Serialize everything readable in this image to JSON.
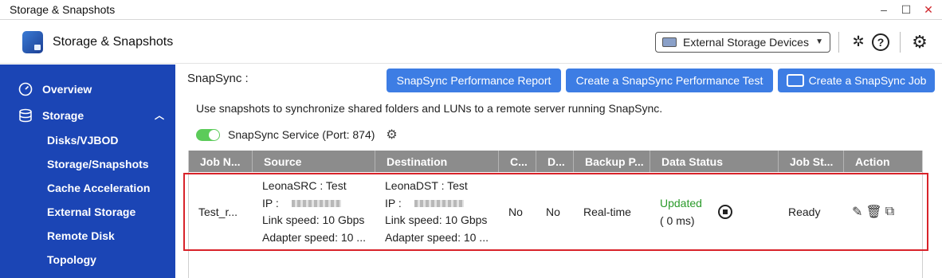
{
  "window": {
    "title": "Storage & Snapshots"
  },
  "app": {
    "title": "Storage & Snapshots",
    "external_select": "External Storage Devices"
  },
  "sidebar": {
    "items": [
      {
        "label": "Overview"
      },
      {
        "label": "Storage"
      }
    ],
    "subitems": [
      {
        "label": "Disks/VJBOD"
      },
      {
        "label": "Storage/Snapshots"
      },
      {
        "label": "Cache Acceleration"
      },
      {
        "label": "External Storage"
      },
      {
        "label": "Remote Disk"
      },
      {
        "label": "Topology"
      }
    ]
  },
  "main": {
    "title": "SnapSync :",
    "buttons": {
      "report": "SnapSync Performance Report",
      "test": "Create a SnapSync Performance Test",
      "job": "Create a SnapSync Job"
    },
    "description": "Use snapshots to synchronize shared folders and LUNs to a remote server running SnapSync.",
    "service_label": "SnapSync Service (Port: 874)"
  },
  "table": {
    "headers": [
      "Job N...",
      "Source",
      "Destination",
      "C...",
      "D...",
      "Backup P...",
      "Data Status",
      "Job St...",
      "Action"
    ],
    "row": {
      "job_name": "Test_r...",
      "source": {
        "name": "LeonaSRC : Test",
        "ip_label": "IP :",
        "link": "Link speed: 10 Gbps",
        "adapter": "Adapter speed: 10 ..."
      },
      "destination": {
        "name": "LeonaDST : Test",
        "ip_label": "IP :",
        "link": "Link speed: 10 Gbps",
        "adapter": "Adapter speed: 10 ..."
      },
      "c": "No",
      "d": "No",
      "backup": "Real-time",
      "data_status": "Updated",
      "data_time": "( 0 ms)",
      "job_status": "Ready"
    }
  },
  "colors": {
    "sidebar": "#1b45b5",
    "button": "#3d7de4",
    "header": "#8c8c8c",
    "highlight": "#d8232a",
    "updated": "#2a9a2a"
  }
}
